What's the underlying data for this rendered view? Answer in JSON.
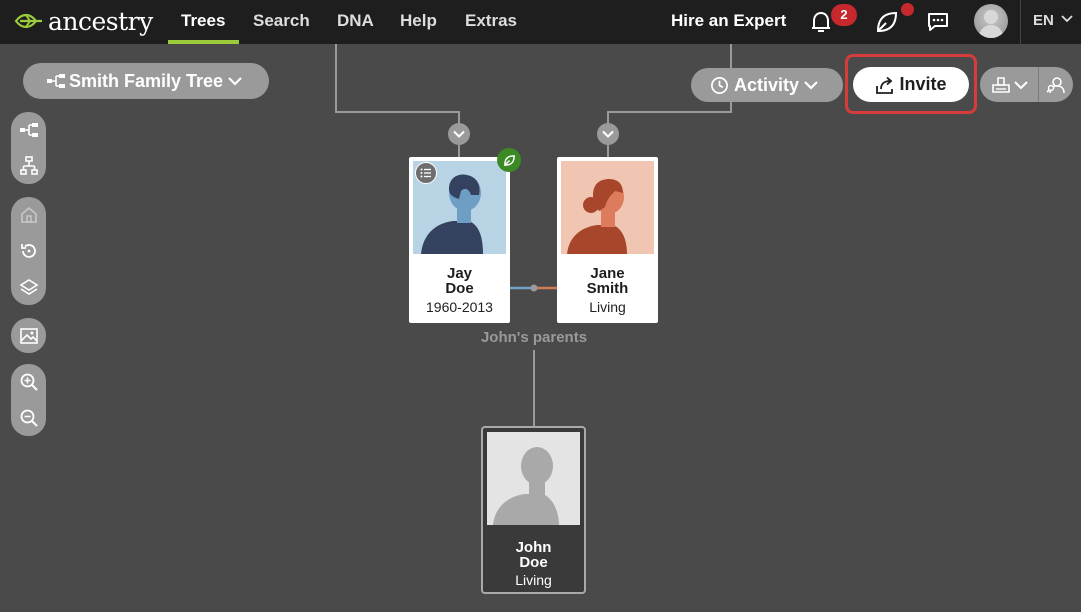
{
  "nav": {
    "logo_text": "ancestry",
    "links": [
      "Trees",
      "Search",
      "DNA",
      "Help",
      "Extras"
    ],
    "active": "Trees",
    "hire_expert": "Hire an Expert",
    "notification_count": "2",
    "language": "EN"
  },
  "toolbar": {
    "tree_name": "Smith Family Tree",
    "activity_label": "Activity",
    "invite_label": "Invite"
  },
  "tree": {
    "father": {
      "first": "Jay",
      "last": "Doe",
      "dates": "1960-2013"
    },
    "mother": {
      "first": "Jane",
      "last": "Smith",
      "dates": "Living"
    },
    "parents_label": "John's parents",
    "child": {
      "first": "John",
      "last": "Doe",
      "dates": "Living"
    }
  },
  "colors": {
    "accent_green": "#9ccc3c",
    "badge_red": "#c6282e",
    "highlight_red": "#d63c3c",
    "background": "#4a4a4a",
    "nav_bg": "#1e1e1e"
  },
  "icons": [
    "leaf-logo-icon",
    "bell-icon",
    "leaf-message-icon",
    "chat-icon",
    "tree-view-icon",
    "pedigree-icon",
    "home-icon",
    "history-icon",
    "layers-icon",
    "image-icon",
    "zoom-in-icon",
    "zoom-out-icon",
    "clock-icon",
    "share-icon",
    "print-icon",
    "find-person-icon"
  ]
}
